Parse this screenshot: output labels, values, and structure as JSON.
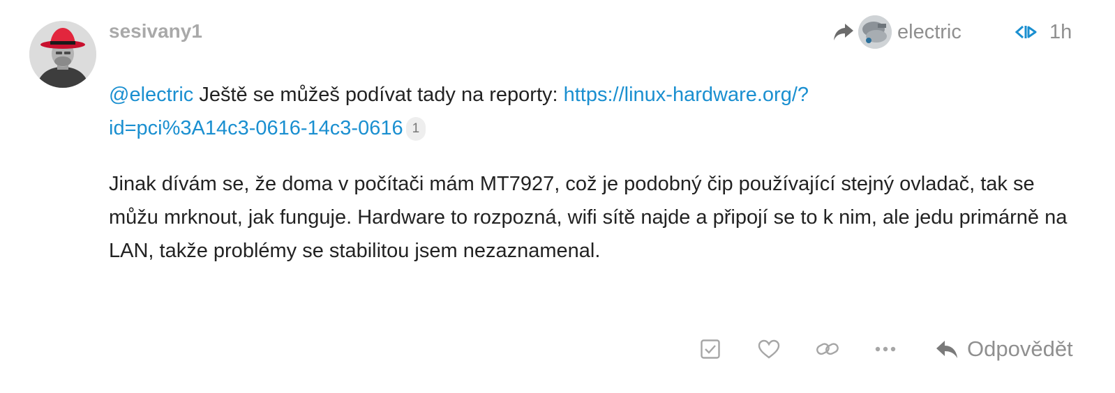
{
  "post": {
    "username": "sesivany1",
    "reply_to": {
      "username": "electric",
      "icon": "share-arrow-icon"
    },
    "date_icon": "sync-arrows-icon",
    "time": "1h",
    "paragraph1": {
      "mention": "@electric",
      "text": " Ještě se můžeš podívat tady na reporty: ",
      "link_line1": "https://linux-hardware.org/?",
      "link_line2": "id=pci%3A14c3-0616-14c3-0616",
      "link_clicks": "1"
    },
    "paragraph2": "Jinak dívám se, že doma v počítači mám MT7927, což je podobný čip používající stejný ovladač, tak se můžu mrknout, jak funguje. Hardware to rozpozná, wifi sítě najde a připojí se to k nim, ale jedu primárně na LAN, takže problémy se stabilitou jsem nezaznamenal.",
    "actions": {
      "solution_icon": "check-square-icon",
      "like_icon": "heart-icon",
      "link_icon": "link-icon",
      "more_icon": "ellipsis-icon",
      "reply_label": "Odpovědět",
      "reply_icon": "reply-icon"
    },
    "colors": {
      "link": "#1a8fd0",
      "muted": "#8f8f8f",
      "text": "#222222"
    }
  }
}
